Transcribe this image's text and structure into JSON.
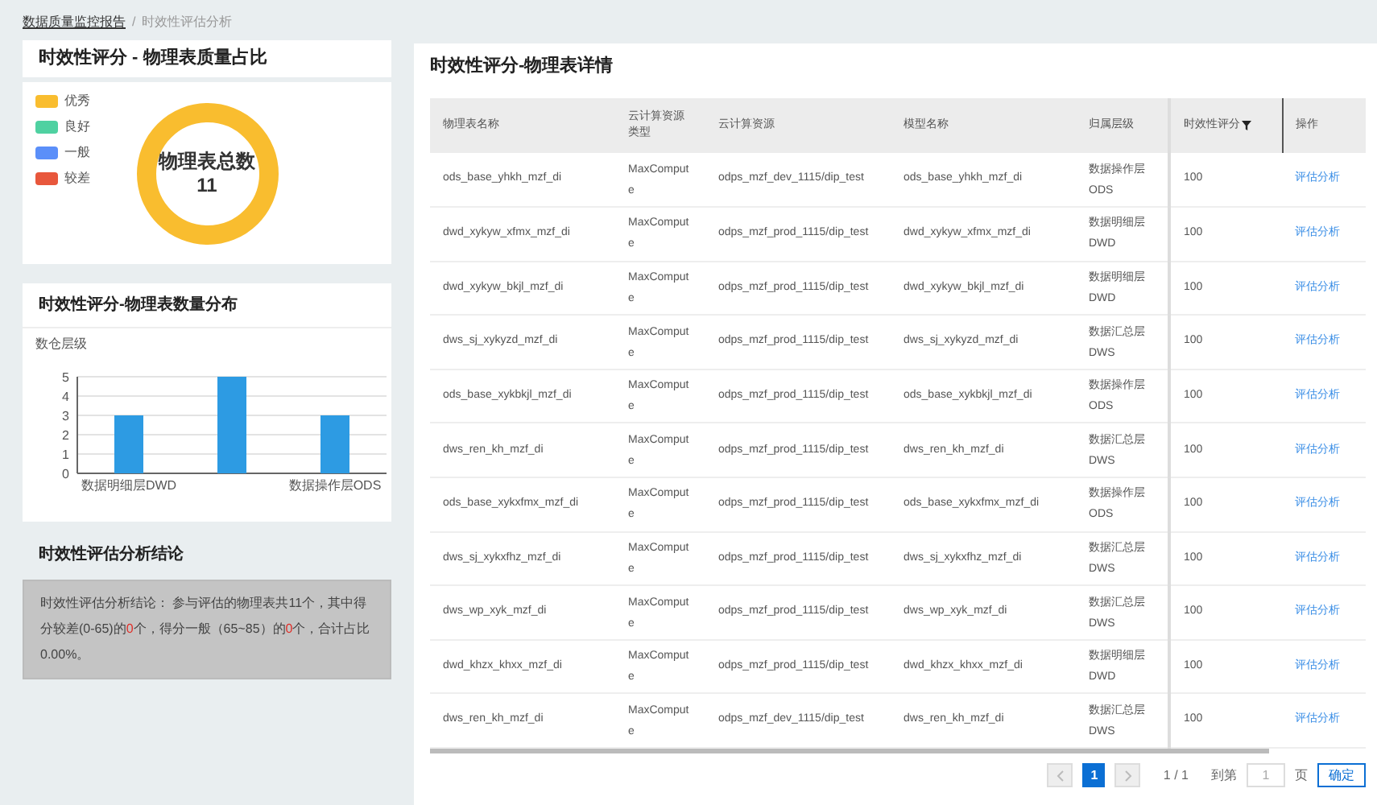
{
  "breadcrumb": {
    "separator": "/",
    "items": [
      {
        "label": "数据质量监控报告",
        "link": true
      },
      {
        "label": "时效性评估分析",
        "link": false
      }
    ]
  },
  "quality_panel": {
    "title": "时效性评分 - 物理表质量占比",
    "center_label": "物理表总数",
    "center_value": "11",
    "legend": [
      {
        "label": "优秀",
        "color": "#f9bd2f"
      },
      {
        "label": "良好",
        "color": "#4fd1a1"
      },
      {
        "label": "一般",
        "color": "#5b8ff9"
      },
      {
        "label": "较差",
        "color": "#e8573c"
      }
    ]
  },
  "distribution_panel": {
    "title": "时效性评分-物理表数量分布",
    "chart_data": {
      "type": "bar",
      "title": "数仓层级",
      "categories": [
        "数据明细层DWD",
        null,
        "数据操作层ODS"
      ],
      "series": [
        {
          "color": "#2d9be3",
          "values": [
            3,
            5,
            3
          ]
        }
      ],
      "ylim": [
        0,
        5
      ],
      "yticks": [
        0,
        1,
        2,
        3,
        4,
        5
      ],
      "grid": true
    }
  },
  "conclusion": {
    "title": "时效性评估分析结论",
    "segments": [
      {
        "text": "时效性评估分析结论： 参与评估的物理表共11个，其中得分较差(0-65)的",
        "highlight": false
      },
      {
        "text": "0",
        "highlight": true
      },
      {
        "text": "个，得分一般（65~85）的",
        "highlight": false
      },
      {
        "text": "0",
        "highlight": true
      },
      {
        "text": "个，合计占比0.00%。",
        "highlight": false
      }
    ]
  },
  "detail_panel": {
    "title": "时效性评分-物理表详情",
    "table": {
      "columns": [
        "物理表名称",
        "云计算资源类型",
        "云计算资源",
        "模型名称",
        "归属层级",
        "时效性评分",
        "操作"
      ],
      "rows": [
        [
          "ods_base_yhkh_mzf_di",
          "MaxCompute",
          "odps_mzf_dev_1115/dip_test",
          "ods_base_yhkh_mzf_di",
          "数据操作层ODS",
          "100",
          "评估分析"
        ],
        [
          "dwd_xykyw_xfmx_mzf_di",
          "MaxCompute",
          "odps_mzf_prod_1115/dip_test",
          "dwd_xykyw_xfmx_mzf_di",
          "数据明细层DWD",
          "100",
          "评估分析"
        ],
        [
          "dwd_xykyw_bkjl_mzf_di",
          "MaxCompute",
          "odps_mzf_prod_1115/dip_test",
          "dwd_xykyw_bkjl_mzf_di",
          "数据明细层DWD",
          "100",
          "评估分析"
        ],
        [
          "dws_sj_xykyzd_mzf_di",
          "MaxCompute",
          "odps_mzf_prod_1115/dip_test",
          "dws_sj_xykyzd_mzf_di",
          "数据汇总层DWS",
          "100",
          "评估分析"
        ],
        [
          "ods_base_xykbkjl_mzf_di",
          "MaxCompute",
          "odps_mzf_prod_1115/dip_test",
          "ods_base_xykbkjl_mzf_di",
          "数据操作层ODS",
          "100",
          "评估分析"
        ],
        [
          "dws_ren_kh_mzf_di",
          "MaxCompute",
          "odps_mzf_prod_1115/dip_test",
          "dws_ren_kh_mzf_di",
          "数据汇总层DWS",
          "100",
          "评估分析"
        ],
        [
          "ods_base_xykxfmx_mzf_di",
          "MaxCompute",
          "odps_mzf_prod_1115/dip_test",
          "ods_base_xykxfmx_mzf_di",
          "数据操作层ODS",
          "100",
          "评估分析"
        ],
        [
          "dws_sj_xykxfhz_mzf_di",
          "MaxCompute",
          "odps_mzf_prod_1115/dip_test",
          "dws_sj_xykxfhz_mzf_di",
          "数据汇总层DWS",
          "100",
          "评估分析"
        ],
        [
          "dws_wp_xyk_mzf_di",
          "MaxCompute",
          "odps_mzf_prod_1115/dip_test",
          "dws_wp_xyk_mzf_di",
          "数据汇总层DWS",
          "100",
          "评估分析"
        ],
        [
          "dwd_khzx_khxx_mzf_di",
          "MaxCompute",
          "odps_mzf_prod_1115/dip_test",
          "dwd_khzx_khxx_mzf_di",
          "数据明细层DWD",
          "100",
          "评估分析"
        ],
        [
          "dws_ren_kh_mzf_di",
          "MaxCompute",
          "odps_mzf_dev_1115/dip_test",
          "dws_ren_kh_mzf_di",
          "数据汇总层DWS",
          "100",
          "评估分析"
        ]
      ]
    },
    "pagination": {
      "pages": [
        {
          "label": "1",
          "selected": true
        }
      ],
      "summary": "1 / 1",
      "goto_label": "到第",
      "goto_value": "1",
      "page_unit": "页",
      "confirm": "确定"
    }
  }
}
